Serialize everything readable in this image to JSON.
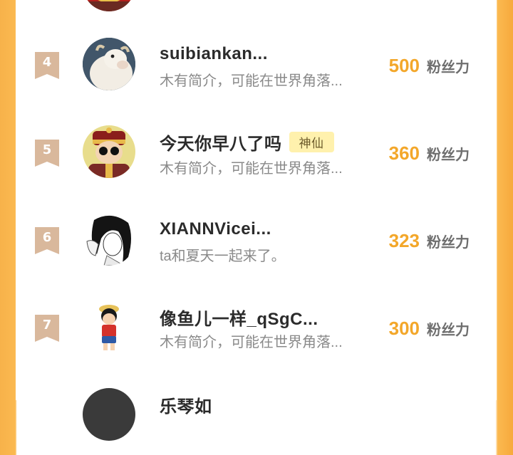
{
  "unit_label": "粉丝力",
  "rows": [
    {
      "rank": "4",
      "name": "suibiankan...",
      "bio": "木有简介，可能在世界角落...",
      "score": "500",
      "avatar": "sheep-avatar"
    },
    {
      "rank": "5",
      "name": "今天你早八了吗",
      "badge": "神仙",
      "bio": "木有简介，可能在世界角落...",
      "score": "360",
      "avatar": "emperor-avatar"
    },
    {
      "rank": "6",
      "name": "XIANNVicei...",
      "bio": "ta和夏天一起来了。",
      "score": "323",
      "avatar": "anime-girl-avatar"
    },
    {
      "rank": "7",
      "name": "像鱼儿一样_qSgC...",
      "bio": "木有简介，可能在世界角落...",
      "score": "300",
      "avatar": "luffy-avatar"
    },
    {
      "name": "乐琴如",
      "avatar": "dark-avatar"
    }
  ],
  "colors": {
    "accent": "#f3a72a",
    "ribbon": "#d9b89c",
    "border": "#fbb950"
  }
}
